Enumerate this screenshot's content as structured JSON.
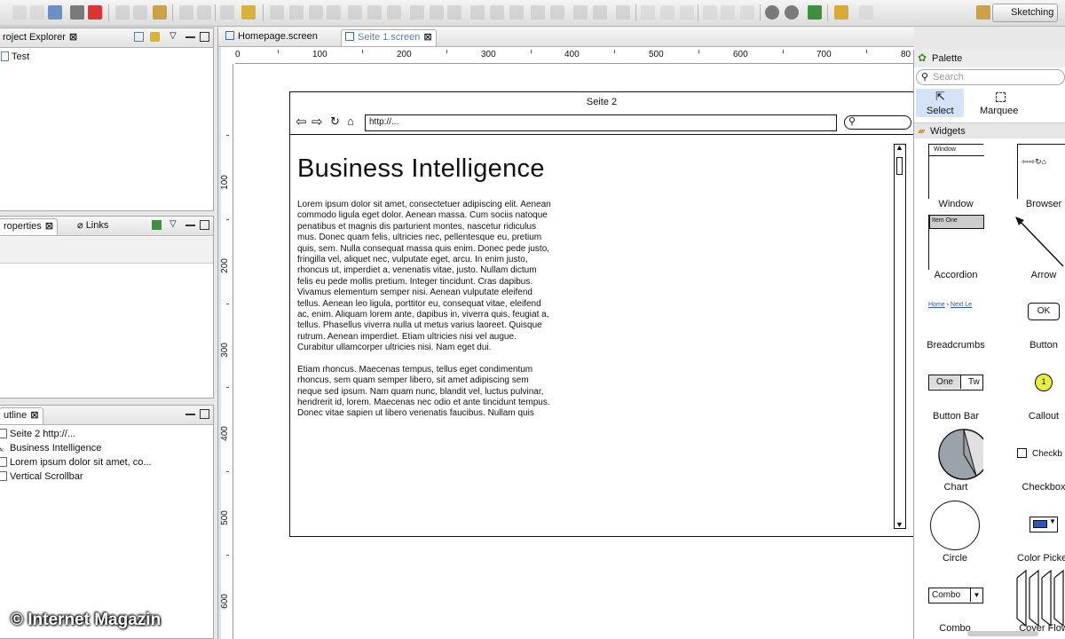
{
  "toolbar": {
    "perspective_label": "Sketching"
  },
  "project_explorer": {
    "title": "roject Explorer",
    "items": [
      "Test"
    ]
  },
  "properties": {
    "tabs": [
      "roperties",
      "Links"
    ]
  },
  "outline": {
    "title": "utline",
    "items": [
      "Seite 2 http://...",
      "Business Intelligence",
      "Lorem ipsum dolor sit amet, co...",
      "Vertical Scrollbar"
    ]
  },
  "editor": {
    "tabs": [
      "Homepage.screen",
      "Seite 1.screen"
    ],
    "ruler_h": [
      "0",
      "100",
      "200",
      "300",
      "400",
      "500",
      "600",
      "700",
      "80"
    ],
    "ruler_v": [
      "100",
      "200",
      "300",
      "400",
      "500",
      "600"
    ]
  },
  "mockup": {
    "window_title": "Seite 2",
    "url": "http://...",
    "heading": "Business Intelligence",
    "paragraph1": "Lorem ipsum dolor sit amet, consectetuer adipiscing elit. Aenean commodo ligula eget dolor. Aenean massa. Cum sociis natoque penatibus et magnis dis parturient montes, nascetur ridiculus mus. Donec quam felis, ultricies nec, pellentesque eu, pretium quis, sem. Nulla consequat massa quis enim. Donec pede justo, fringilla vel, aliquet nec, vulputate eget, arcu. In enim justo, rhoncus ut, imperdiet a, venenatis vitae, justo. Nullam dictum felis eu pede mollis pretium. Integer tincidunt. Cras dapibus. Vivamus elementum semper nisi. Aenean vulputate eleifend tellus. Aenean leo ligula, porttitor eu, consequat vitae, eleifend ac, enim. Aliquam lorem ante, dapibus in, viverra quis, feugiat a, tellus. Phasellus viverra nulla ut metus varius laoreet. Quisque rutrum. Aenean imperdiet. Etiam ultricies nisi vel augue. Curabitur ullamcorper ultricies nisi. Nam eget dui.",
    "paragraph2": "Etiam rhoncus. Maecenas tempus, tellus eget condimentum rhoncus, sem quam semper libero, sit amet adipiscing sem neque sed ipsum. Nam quam nunc, blandit vel, luctus pulvinar, hendrerit id, lorem. Maecenas nec odio et ante tincidunt tempus. Donec vitae sapien ut libero venenatis faucibus. Nullam quis"
  },
  "palette": {
    "title": "Palette",
    "search_placeholder": "Search",
    "tools": [
      "Select",
      "Marquee"
    ],
    "section": "Widgets",
    "widgets": [
      "Window",
      "Browser",
      "Accordion",
      "Arrow",
      "Breadcrumbs",
      "Button",
      "Button Bar",
      "Callout",
      "Chart",
      "Checkbox",
      "Circle",
      "Color Picker",
      "Combo",
      "Cover Flow"
    ],
    "window_preview": "Window",
    "accordion_preview": "Item One",
    "breadcrumb_home": "Home",
    "breadcrumb_next": "Next Le",
    "button_preview": "OK",
    "buttonbar_one": "One",
    "buttonbar_two": "Tw",
    "callout_number": "1",
    "checkbox_preview": "Checkb",
    "combo_preview": "Combo"
  },
  "watermark": "© Internet Magazin"
}
